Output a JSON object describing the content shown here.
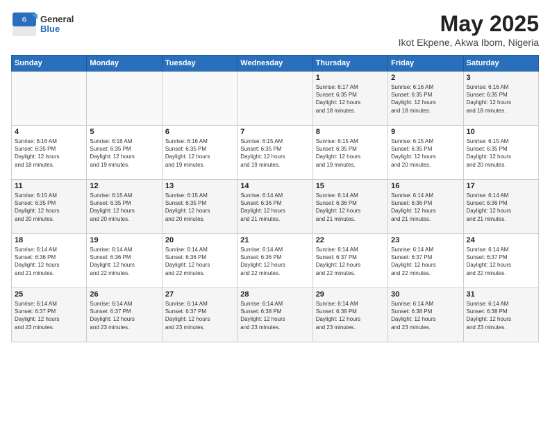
{
  "header": {
    "logo_general": "General",
    "logo_blue": "Blue",
    "title": "May 2025",
    "subtitle": "Ikot Ekpene, Akwa Ibom, Nigeria"
  },
  "weekdays": [
    "Sunday",
    "Monday",
    "Tuesday",
    "Wednesday",
    "Thursday",
    "Friday",
    "Saturday"
  ],
  "weeks": [
    [
      {
        "day": "",
        "info": ""
      },
      {
        "day": "",
        "info": ""
      },
      {
        "day": "",
        "info": ""
      },
      {
        "day": "",
        "info": ""
      },
      {
        "day": "1",
        "info": "Sunrise: 6:17 AM\nSunset: 6:35 PM\nDaylight: 12 hours\nand 18 minutes."
      },
      {
        "day": "2",
        "info": "Sunrise: 6:16 AM\nSunset: 6:35 PM\nDaylight: 12 hours\nand 18 minutes."
      },
      {
        "day": "3",
        "info": "Sunrise: 6:16 AM\nSunset: 6:35 PM\nDaylight: 12 hours\nand 18 minutes."
      }
    ],
    [
      {
        "day": "4",
        "info": "Sunrise: 6:16 AM\nSunset: 6:35 PM\nDaylight: 12 hours\nand 18 minutes."
      },
      {
        "day": "5",
        "info": "Sunrise: 6:16 AM\nSunset: 6:35 PM\nDaylight: 12 hours\nand 19 minutes."
      },
      {
        "day": "6",
        "info": "Sunrise: 6:16 AM\nSunset: 6:35 PM\nDaylight: 12 hours\nand 19 minutes."
      },
      {
        "day": "7",
        "info": "Sunrise: 6:15 AM\nSunset: 6:35 PM\nDaylight: 12 hours\nand 19 minutes."
      },
      {
        "day": "8",
        "info": "Sunrise: 6:15 AM\nSunset: 6:35 PM\nDaylight: 12 hours\nand 19 minutes."
      },
      {
        "day": "9",
        "info": "Sunrise: 6:15 AM\nSunset: 6:35 PM\nDaylight: 12 hours\nand 20 minutes."
      },
      {
        "day": "10",
        "info": "Sunrise: 6:15 AM\nSunset: 6:35 PM\nDaylight: 12 hours\nand 20 minutes."
      }
    ],
    [
      {
        "day": "11",
        "info": "Sunrise: 6:15 AM\nSunset: 6:35 PM\nDaylight: 12 hours\nand 20 minutes."
      },
      {
        "day": "12",
        "info": "Sunrise: 6:15 AM\nSunset: 6:35 PM\nDaylight: 12 hours\nand 20 minutes."
      },
      {
        "day": "13",
        "info": "Sunrise: 6:15 AM\nSunset: 6:35 PM\nDaylight: 12 hours\nand 20 minutes."
      },
      {
        "day": "14",
        "info": "Sunrise: 6:14 AM\nSunset: 6:36 PM\nDaylight: 12 hours\nand 21 minutes."
      },
      {
        "day": "15",
        "info": "Sunrise: 6:14 AM\nSunset: 6:36 PM\nDaylight: 12 hours\nand 21 minutes."
      },
      {
        "day": "16",
        "info": "Sunrise: 6:14 AM\nSunset: 6:36 PM\nDaylight: 12 hours\nand 21 minutes."
      },
      {
        "day": "17",
        "info": "Sunrise: 6:14 AM\nSunset: 6:36 PM\nDaylight: 12 hours\nand 21 minutes."
      }
    ],
    [
      {
        "day": "18",
        "info": "Sunrise: 6:14 AM\nSunset: 6:36 PM\nDaylight: 12 hours\nand 21 minutes."
      },
      {
        "day": "19",
        "info": "Sunrise: 6:14 AM\nSunset: 6:36 PM\nDaylight: 12 hours\nand 22 minutes."
      },
      {
        "day": "20",
        "info": "Sunrise: 6:14 AM\nSunset: 6:36 PM\nDaylight: 12 hours\nand 22 minutes."
      },
      {
        "day": "21",
        "info": "Sunrise: 6:14 AM\nSunset: 6:36 PM\nDaylight: 12 hours\nand 22 minutes."
      },
      {
        "day": "22",
        "info": "Sunrise: 6:14 AM\nSunset: 6:37 PM\nDaylight: 12 hours\nand 22 minutes."
      },
      {
        "day": "23",
        "info": "Sunrise: 6:14 AM\nSunset: 6:37 PM\nDaylight: 12 hours\nand 22 minutes."
      },
      {
        "day": "24",
        "info": "Sunrise: 6:14 AM\nSunset: 6:37 PM\nDaylight: 12 hours\nand 22 minutes."
      }
    ],
    [
      {
        "day": "25",
        "info": "Sunrise: 6:14 AM\nSunset: 6:37 PM\nDaylight: 12 hours\nand 23 minutes."
      },
      {
        "day": "26",
        "info": "Sunrise: 6:14 AM\nSunset: 6:37 PM\nDaylight: 12 hours\nand 23 minutes."
      },
      {
        "day": "27",
        "info": "Sunrise: 6:14 AM\nSunset: 6:37 PM\nDaylight: 12 hours\nand 23 minutes."
      },
      {
        "day": "28",
        "info": "Sunrise: 6:14 AM\nSunset: 6:38 PM\nDaylight: 12 hours\nand 23 minutes."
      },
      {
        "day": "29",
        "info": "Sunrise: 6:14 AM\nSunset: 6:38 PM\nDaylight: 12 hours\nand 23 minutes."
      },
      {
        "day": "30",
        "info": "Sunrise: 6:14 AM\nSunset: 6:38 PM\nDaylight: 12 hours\nand 23 minutes."
      },
      {
        "day": "31",
        "info": "Sunrise: 6:14 AM\nSunset: 6:38 PM\nDaylight: 12 hours\nand 23 minutes."
      }
    ]
  ]
}
